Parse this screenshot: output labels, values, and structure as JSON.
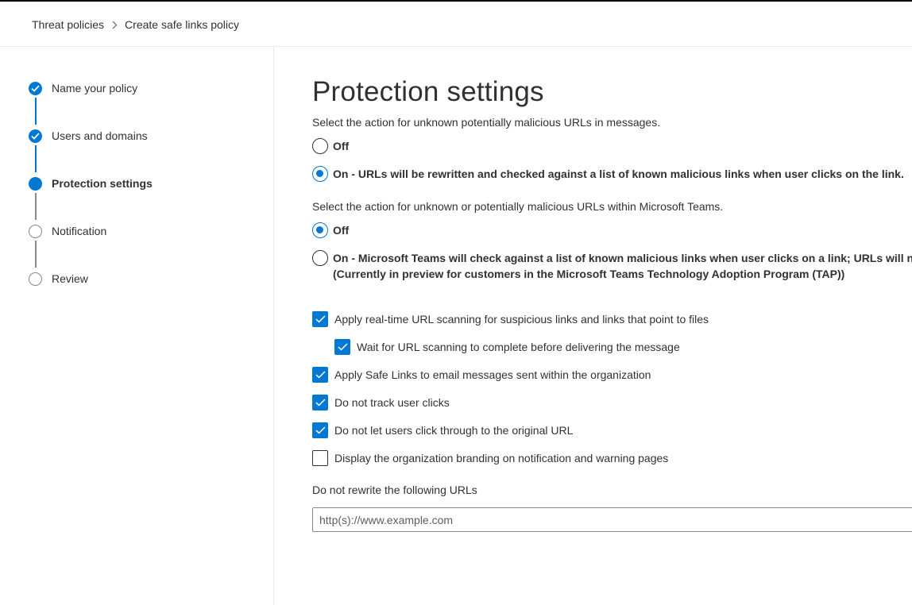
{
  "breadcrumb": {
    "items": [
      "Threat policies",
      "Create safe links policy"
    ]
  },
  "wizard": {
    "steps": [
      {
        "label": "Name your policy",
        "state": "completed"
      },
      {
        "label": "Users and domains",
        "state": "completed"
      },
      {
        "label": "Protection settings",
        "state": "current"
      },
      {
        "label": "Notification",
        "state": "pending"
      },
      {
        "label": "Review",
        "state": "pending"
      }
    ]
  },
  "main": {
    "title": "Protection settings",
    "urls_question": "Select the action for unknown potentially malicious URLs in messages.",
    "urls_options": [
      {
        "label": "Off",
        "selected": false
      },
      {
        "label": "On - URLs will be rewritten and checked against a list of known malicious links when user clicks on the link.",
        "selected": true
      }
    ],
    "teams_question": "Select the action for unknown or potentially malicious URLs within Microsoft Teams.",
    "teams_options": [
      {
        "label": "Off",
        "selected": true
      },
      {
        "label": "On - Microsoft Teams will check against a list of known malicious links when user clicks on a link; URLs will not",
        "label_line2": "(Currently in preview for customers in the Microsoft Teams Technology Adoption Program (TAP))",
        "selected": false
      }
    ],
    "checkboxes": [
      {
        "label": "Apply real-time URL scanning for suspicious links and links that point to files",
        "checked": true
      },
      {
        "label": "Wait for URL scanning to complete before delivering the message",
        "checked": true
      },
      {
        "label": "Apply Safe Links to email messages sent within the organization",
        "checked": true
      },
      {
        "label": "Do not track user clicks",
        "checked": true
      },
      {
        "label": "Do not let users click through to the original URL",
        "checked": true
      },
      {
        "label": "Display the organization branding on notification and warning pages",
        "checked": false
      }
    ],
    "no_rewrite_label": "Do not rewrite the following URLs",
    "no_rewrite_placeholder": "http(s)://www.example.com"
  },
  "colors": {
    "accent": "#0078d4",
    "text": "#323130",
    "divider": "#edebe9"
  }
}
